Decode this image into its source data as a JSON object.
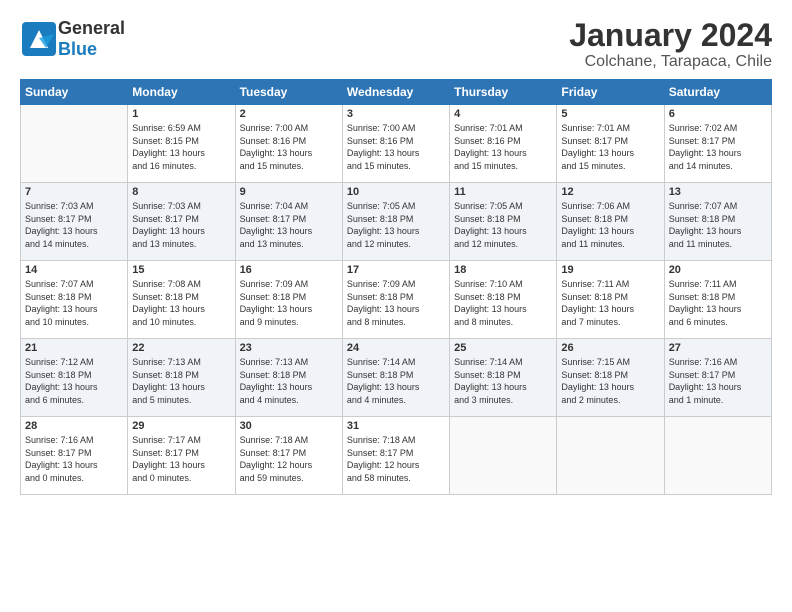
{
  "header": {
    "logo_general": "General",
    "logo_blue": "Blue",
    "title": "January 2024",
    "subtitle": "Colchane, Tarapaca, Chile"
  },
  "calendar": {
    "days": [
      "Sunday",
      "Monday",
      "Tuesday",
      "Wednesday",
      "Thursday",
      "Friday",
      "Saturday"
    ],
    "weeks": [
      [
        {
          "day": "",
          "content": ""
        },
        {
          "day": "1",
          "content": "Sunrise: 6:59 AM\nSunset: 8:15 PM\nDaylight: 13 hours\nand 16 minutes."
        },
        {
          "day": "2",
          "content": "Sunrise: 7:00 AM\nSunset: 8:16 PM\nDaylight: 13 hours\nand 15 minutes."
        },
        {
          "day": "3",
          "content": "Sunrise: 7:00 AM\nSunset: 8:16 PM\nDaylight: 13 hours\nand 15 minutes."
        },
        {
          "day": "4",
          "content": "Sunrise: 7:01 AM\nSunset: 8:16 PM\nDaylight: 13 hours\nand 15 minutes."
        },
        {
          "day": "5",
          "content": "Sunrise: 7:01 AM\nSunset: 8:17 PM\nDaylight: 13 hours\nand 15 minutes."
        },
        {
          "day": "6",
          "content": "Sunrise: 7:02 AM\nSunset: 8:17 PM\nDaylight: 13 hours\nand 14 minutes."
        }
      ],
      [
        {
          "day": "7",
          "content": "Sunrise: 7:03 AM\nSunset: 8:17 PM\nDaylight: 13 hours\nand 14 minutes."
        },
        {
          "day": "8",
          "content": "Sunrise: 7:03 AM\nSunset: 8:17 PM\nDaylight: 13 hours\nand 13 minutes."
        },
        {
          "day": "9",
          "content": "Sunrise: 7:04 AM\nSunset: 8:17 PM\nDaylight: 13 hours\nand 13 minutes."
        },
        {
          "day": "10",
          "content": "Sunrise: 7:05 AM\nSunset: 8:18 PM\nDaylight: 13 hours\nand 12 minutes."
        },
        {
          "day": "11",
          "content": "Sunrise: 7:05 AM\nSunset: 8:18 PM\nDaylight: 13 hours\nand 12 minutes."
        },
        {
          "day": "12",
          "content": "Sunrise: 7:06 AM\nSunset: 8:18 PM\nDaylight: 13 hours\nand 11 minutes."
        },
        {
          "day": "13",
          "content": "Sunrise: 7:07 AM\nSunset: 8:18 PM\nDaylight: 13 hours\nand 11 minutes."
        }
      ],
      [
        {
          "day": "14",
          "content": "Sunrise: 7:07 AM\nSunset: 8:18 PM\nDaylight: 13 hours\nand 10 minutes."
        },
        {
          "day": "15",
          "content": "Sunrise: 7:08 AM\nSunset: 8:18 PM\nDaylight: 13 hours\nand 10 minutes."
        },
        {
          "day": "16",
          "content": "Sunrise: 7:09 AM\nSunset: 8:18 PM\nDaylight: 13 hours\nand 9 minutes."
        },
        {
          "day": "17",
          "content": "Sunrise: 7:09 AM\nSunset: 8:18 PM\nDaylight: 13 hours\nand 8 minutes."
        },
        {
          "day": "18",
          "content": "Sunrise: 7:10 AM\nSunset: 8:18 PM\nDaylight: 13 hours\nand 8 minutes."
        },
        {
          "day": "19",
          "content": "Sunrise: 7:11 AM\nSunset: 8:18 PM\nDaylight: 13 hours\nand 7 minutes."
        },
        {
          "day": "20",
          "content": "Sunrise: 7:11 AM\nSunset: 8:18 PM\nDaylight: 13 hours\nand 6 minutes."
        }
      ],
      [
        {
          "day": "21",
          "content": "Sunrise: 7:12 AM\nSunset: 8:18 PM\nDaylight: 13 hours\nand 6 minutes."
        },
        {
          "day": "22",
          "content": "Sunrise: 7:13 AM\nSunset: 8:18 PM\nDaylight: 13 hours\nand 5 minutes."
        },
        {
          "day": "23",
          "content": "Sunrise: 7:13 AM\nSunset: 8:18 PM\nDaylight: 13 hours\nand 4 minutes."
        },
        {
          "day": "24",
          "content": "Sunrise: 7:14 AM\nSunset: 8:18 PM\nDaylight: 13 hours\nand 4 minutes."
        },
        {
          "day": "25",
          "content": "Sunrise: 7:14 AM\nSunset: 8:18 PM\nDaylight: 13 hours\nand 3 minutes."
        },
        {
          "day": "26",
          "content": "Sunrise: 7:15 AM\nSunset: 8:18 PM\nDaylight: 13 hours\nand 2 minutes."
        },
        {
          "day": "27",
          "content": "Sunrise: 7:16 AM\nSunset: 8:17 PM\nDaylight: 13 hours\nand 1 minute."
        }
      ],
      [
        {
          "day": "28",
          "content": "Sunrise: 7:16 AM\nSunset: 8:17 PM\nDaylight: 13 hours\nand 0 minutes."
        },
        {
          "day": "29",
          "content": "Sunrise: 7:17 AM\nSunset: 8:17 PM\nDaylight: 13 hours\nand 0 minutes."
        },
        {
          "day": "30",
          "content": "Sunrise: 7:18 AM\nSunset: 8:17 PM\nDaylight: 12 hours\nand 59 minutes."
        },
        {
          "day": "31",
          "content": "Sunrise: 7:18 AM\nSunset: 8:17 PM\nDaylight: 12 hours\nand 58 minutes."
        },
        {
          "day": "",
          "content": ""
        },
        {
          "day": "",
          "content": ""
        },
        {
          "day": "",
          "content": ""
        }
      ]
    ]
  }
}
